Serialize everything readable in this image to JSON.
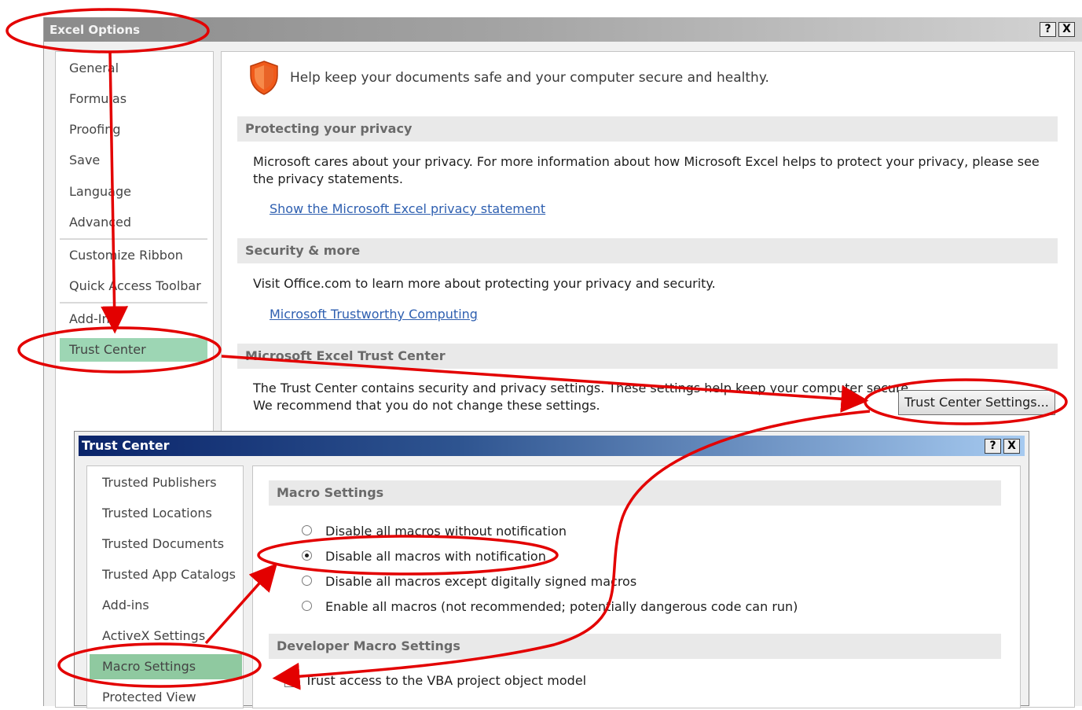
{
  "excel_options": {
    "title": "Excel Options",
    "help_button": "?",
    "close_button": "X",
    "nav": [
      "General",
      "Formulas",
      "Proofing",
      "Save",
      "Language",
      "Advanced",
      "Customize Ribbon",
      "Quick Access Toolbar",
      "Add-Ins",
      "Trust Center"
    ],
    "selected_nav": "Trust Center",
    "header_text": "Help keep your documents safe and your computer secure and healthy.",
    "sections": {
      "privacy": {
        "title": "Protecting your privacy",
        "text": "Microsoft cares about your privacy. For more information about how Microsoft Excel helps to protect your privacy, please see the privacy statements.",
        "link": "Show the Microsoft Excel privacy statement"
      },
      "security": {
        "title": "Security & more",
        "text": "Visit Office.com to learn more about protecting your privacy and security.",
        "link": "Microsoft Trustworthy Computing"
      },
      "trust_center": {
        "title": "Microsoft Excel Trust Center",
        "text_line1": "The Trust Center contains security and privacy settings. These settings help keep your computer secure.",
        "text_line2": "We recommend that you do not change these settings.",
        "button": "Trust Center Settings..."
      }
    }
  },
  "trust_center": {
    "title": "Trust Center",
    "help_button": "?",
    "close_button": "X",
    "nav": [
      "Trusted Publishers",
      "Trusted Locations",
      "Trusted Documents",
      "Trusted App Catalogs",
      "Add-ins",
      "ActiveX Settings",
      "Macro Settings",
      "Protected View"
    ],
    "selected_nav": "Macro Settings",
    "macro_settings_title": "Macro Settings",
    "macro_options": [
      {
        "label": "Disable all macros without notification",
        "checked": false
      },
      {
        "label": "Disable all macros with notification",
        "checked": true
      },
      {
        "label": "Disable all macros except digitally signed macros",
        "checked": false
      },
      {
        "label": "Enable all macros (not recommended; potentially dangerous code can run)",
        "checked": false
      }
    ],
    "developer_title": "Developer Macro Settings",
    "developer_option": {
      "label": "Trust access to the VBA project object model",
      "checked": false
    }
  },
  "colors": {
    "annotation": "#e30000",
    "selected_nav": "#9dd6b4",
    "link": "#2e5fb0",
    "shield": "#f05a1a"
  }
}
